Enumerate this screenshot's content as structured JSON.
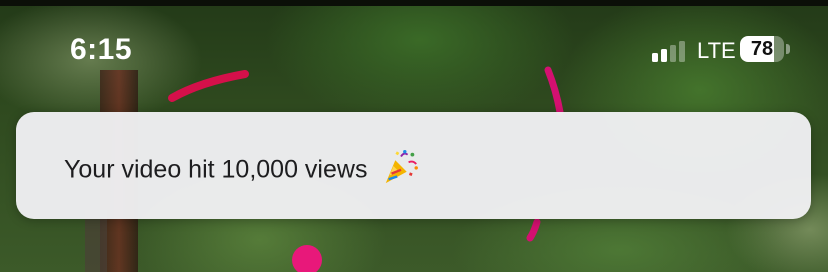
{
  "status_bar": {
    "time": "6:15",
    "network": "LTE",
    "battery_percent": "78",
    "battery_level": 0.78,
    "signal_bars_active": 2,
    "signal_bars_total": 4
  },
  "notification": {
    "message": "Your video hit 10,000 views",
    "emoji_icon": "party-popper-icon"
  },
  "colors": {
    "accent_arc": "#d4104a",
    "accent_dot": "#e8187a",
    "toast_bg": "#f0f0f2",
    "text": "#1d1d1f"
  }
}
